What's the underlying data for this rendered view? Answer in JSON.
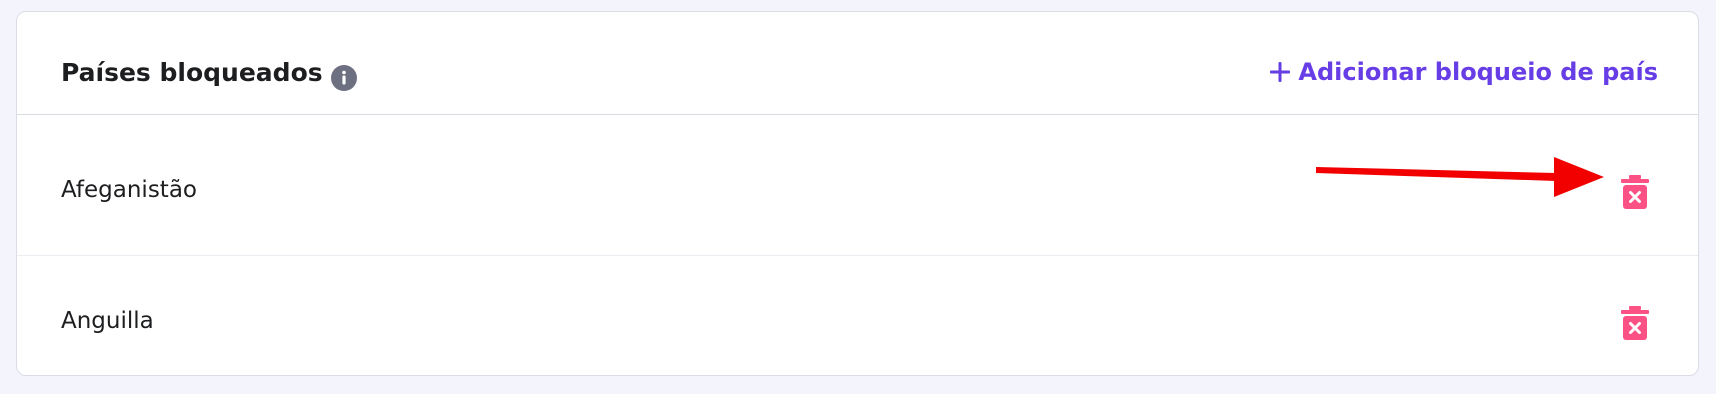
{
  "blocked_countries": {
    "title": "Países bloqueados",
    "add_label": "Adicionar bloqueio de país",
    "items": [
      {
        "label": "Afeganistão"
      },
      {
        "label": "Anguilla"
      }
    ]
  },
  "icons": {
    "info": "info-icon",
    "add": "plus-icon",
    "delete": "trash-x-icon",
    "annotation": "red-arrow-icon"
  },
  "colors": {
    "accent": "#673de6",
    "danger": "#fc5185",
    "annotation_arrow": "#f20000",
    "text": "#1d1e20",
    "info_icon": "#6d7081"
  }
}
